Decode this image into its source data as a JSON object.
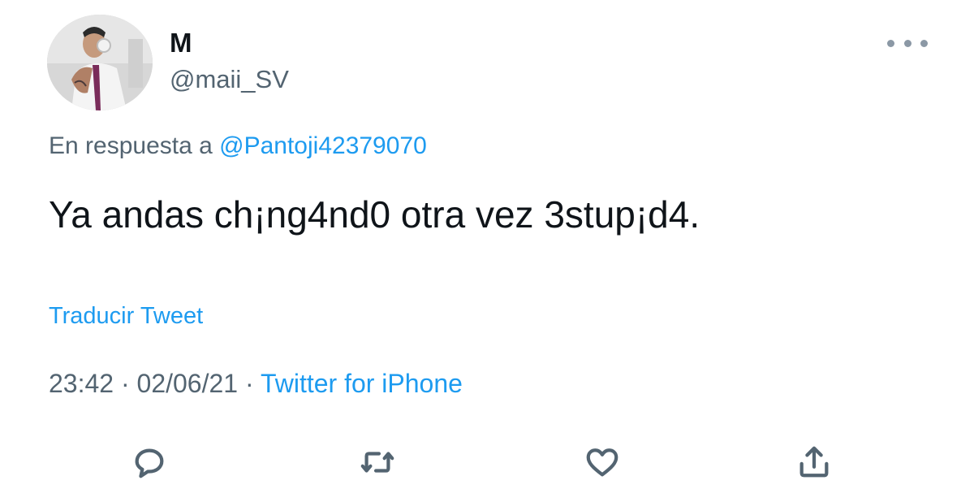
{
  "author": {
    "display_name": "M",
    "handle": "@maii_SV"
  },
  "reply": {
    "prefix": "En respuesta a",
    "mention": "@Pantoji42379070"
  },
  "tweet": {
    "text": "Ya andas ch¡ng4nd0 otra vez 3stup¡d4.",
    "translate_label": "Traducir Tweet",
    "time": "23:42",
    "date": "02/06/21",
    "source": "Twitter for iPhone",
    "separator": "·"
  },
  "actions": [
    {
      "name": "reply",
      "icon": "speech-bubble-icon"
    },
    {
      "name": "retweet",
      "icon": "retweet-icon"
    },
    {
      "name": "like",
      "icon": "heart-icon"
    },
    {
      "name": "share",
      "icon": "share-icon"
    }
  ],
  "colors": {
    "accent": "#1d9bf0",
    "secondary_text": "#536471",
    "primary_text": "#0f1419"
  }
}
